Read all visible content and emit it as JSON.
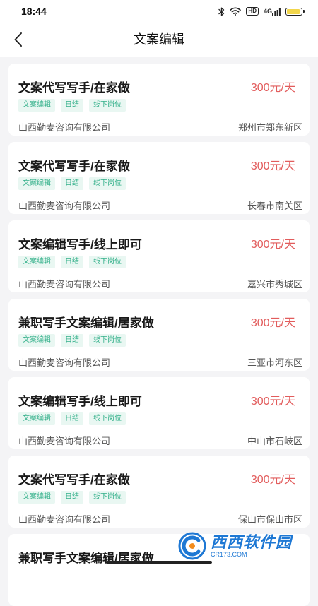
{
  "status_bar": {
    "time": "18:44",
    "network_label": "4G",
    "hd_label": "HD",
    "battery_level": 0.9
  },
  "header": {
    "title": "文案编辑"
  },
  "jobs": [
    {
      "title": "文案代写写手/在家做",
      "salary": "300元/天",
      "tags": [
        "文案编辑",
        "日结",
        "线下岗位"
      ],
      "company": "山西勤麦咨询有限公司",
      "location": "郑州市郑东新区"
    },
    {
      "title": "文案代写写手/在家做",
      "salary": "300元/天",
      "tags": [
        "文案编辑",
        "日结",
        "线下岗位"
      ],
      "company": "山西勤麦咨询有限公司",
      "location": "长春市南关区"
    },
    {
      "title": "文案编辑写手/线上即可",
      "salary": "300元/天",
      "tags": [
        "文案编辑",
        "日结",
        "线下岗位"
      ],
      "company": "山西勤麦咨询有限公司",
      "location": "嘉兴市秀城区"
    },
    {
      "title": "兼职写手文案编辑/居家做",
      "salary": "300元/天",
      "tags": [
        "文案编辑",
        "日结",
        "线下岗位"
      ],
      "company": "山西勤麦咨询有限公司",
      "location": "三亚市河东区"
    },
    {
      "title": "文案编辑写手/线上即可",
      "salary": "300元/天",
      "tags": [
        "文案编辑",
        "日结",
        "线下岗位"
      ],
      "company": "山西勤麦咨询有限公司",
      "location": "中山市石岐区"
    },
    {
      "title": "文案代写写手/在家做",
      "salary": "300元/天",
      "tags": [
        "文案编辑",
        "日结",
        "线下岗位"
      ],
      "company": "山西勤麦咨询有限公司",
      "location": "保山市保山市区"
    },
    {
      "title": "兼职写手文案编辑/居家做",
      "salary": "",
      "tags": [],
      "company": "",
      "location": ""
    }
  ],
  "watermark": {
    "brand": "西西软件园",
    "url": "CR173.COM"
  },
  "colors": {
    "accent_salary": "#e25c5c",
    "tag_text": "#33b08a",
    "tag_bg": "#e9f7f2",
    "page_bg": "#f4f4f6",
    "watermark": "#1e78d4"
  },
  "icons": {
    "back": "chevron-left-icon",
    "bluetooth": "bluetooth-icon",
    "wifi": "wifi-icon",
    "signal": "signal-icon",
    "battery": "battery-icon"
  }
}
